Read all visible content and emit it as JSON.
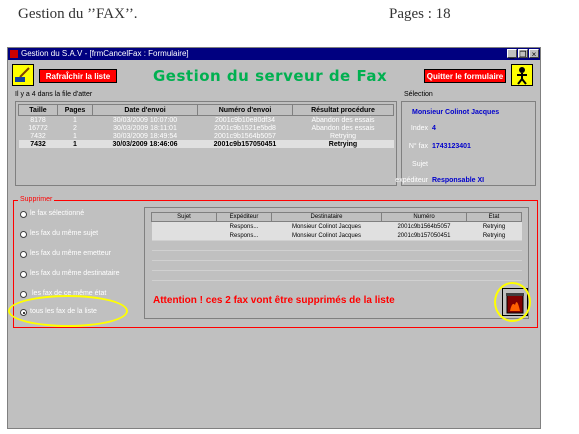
{
  "doc": {
    "left": "Gestion du ’’FAX’’.",
    "right": "Pages : 18"
  },
  "window": {
    "title": "Gestion du S.A.V - [frmCancelFax : Formulaire]",
    "min_glyph": "_",
    "max_glyph": "❐",
    "close_glyph": "×"
  },
  "toolbar": {
    "refresh_label": "RafraÎchir la liste",
    "quit_label": "Quitter le formulaire",
    "heading": "Gestion du serveur de Fax"
  },
  "queue": {
    "count_label": "Il y a 4 dans la file d'atter",
    "columns": [
      "Taille",
      "Pages",
      "Date d'envoi",
      "Numéro d'envoi",
      "Résultat procédure"
    ],
    "rows": [
      [
        "8178",
        "1",
        "30/03/2009 10:07:00",
        "2001c9b10e80df34",
        "Abandon des essais"
      ],
      [
        "16772",
        "2",
        "30/03/2009 18:11:01",
        "2001c9b1521e5bd8",
        "Abandon des essais"
      ],
      [
        "7432",
        "1",
        "30/03/2009 18:49:54",
        "2001c9b1564b5057",
        "Retrying"
      ],
      [
        "7432",
        "1",
        "30/03/2009 18:46:06",
        "2001c9b157050451",
        "Retrying"
      ]
    ]
  },
  "selection": {
    "title": "Sélection",
    "name": "Monsieur Colinot Jacques",
    "index_label": "Index",
    "index_value": "4",
    "fax_label": "N° fax",
    "fax_value": "1743123401",
    "subject_label": "Sujet",
    "subject_value": "",
    "sender_label": "expéditeur",
    "sender_value": "Responsable XI"
  },
  "delete": {
    "title": "Supprimer",
    "options": [
      "le fax sélectionné",
      "les fax du même sujet",
      "les fax du même emetteur",
      "les fax du même destinataire",
      "les fax de ce même état",
      "tous les fax de la liste"
    ],
    "selected_index": 5,
    "columns": [
      "Sujet",
      "Expéditeur",
      "Destinataire",
      "Numéro",
      "Etat"
    ],
    "rows": [
      [
        "",
        "Respons...",
        "Monsieur Colinot Jacques",
        "2001c9b1564b5057",
        "Retrying"
      ],
      [
        "",
        "Respons...",
        "Monsieur Colinot Jacques",
        "2001c9b157050451",
        "Retrying"
      ]
    ],
    "warning": "Attention ! ces 2 fax vont être supprimés de la liste"
  },
  "colors": {
    "title_bar": "#000080",
    "heading": "#00b050",
    "button_red": "#ff0000",
    "highlight": "#ffff00"
  },
  "icons": [
    "broom-icon",
    "exit-person-icon",
    "trash-fire-icon"
  ]
}
